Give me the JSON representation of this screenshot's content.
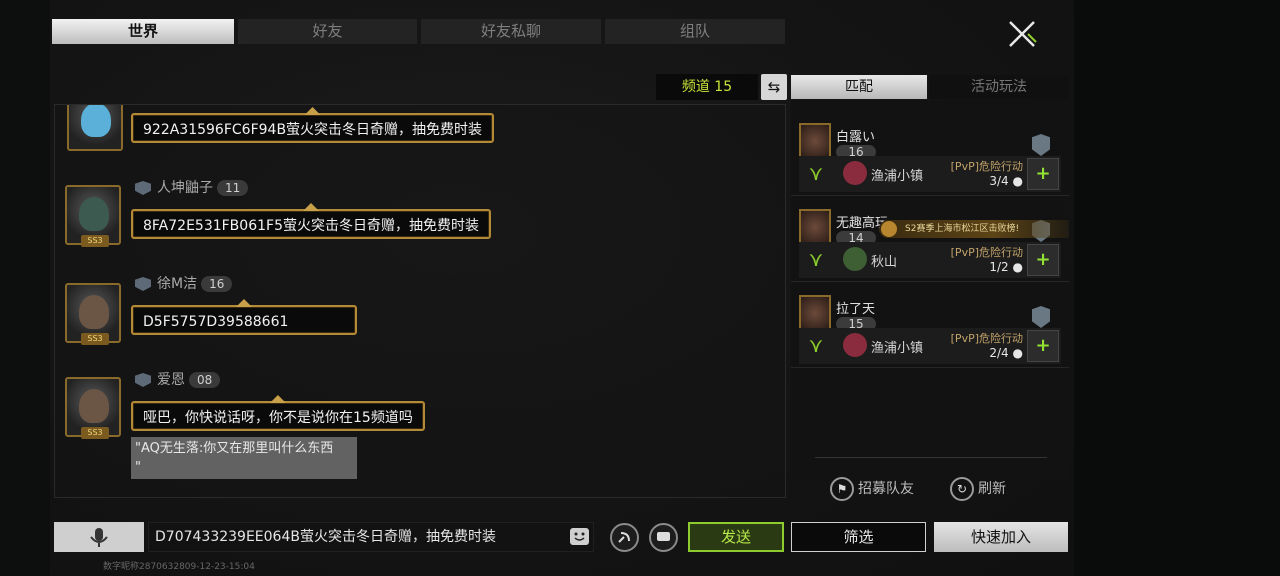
{
  "tabs": [
    {
      "label": "世界",
      "active": true
    },
    {
      "label": "好友",
      "active": false
    },
    {
      "label": "好友私聊",
      "active": false
    },
    {
      "label": "组队",
      "active": false
    }
  ],
  "channel": {
    "label": "频道 15"
  },
  "messages": [
    {
      "name": "",
      "level": "",
      "text": "922A31596FC6F94B萤火突击冬日奇赠，抽免费时装"
    },
    {
      "name": "人坤鼬子",
      "level": "11",
      "text": "8FA72E531FB061F5萤火突击冬日奇赠，抽免费时装"
    },
    {
      "name": "徐M洁",
      "level": "16",
      "text": "D5F5757D39588661"
    },
    {
      "name": "爱恩",
      "level": "08",
      "text": "哑巴，你快说话呀，你不是说你在15频道吗",
      "quote": "\"AQ无生落:你又在那里叫什么东西\n\""
    }
  ],
  "avatar_tag": "SS3",
  "input": {
    "value": "D707433239EE064B萤火突击冬日奇赠，抽免费时装"
  },
  "send_label": "发送",
  "filter_label": "筛选",
  "quickjoin_label": "快速加入",
  "footer_id": "数字昵称2870632809-12-23-15:04",
  "right_tabs": [
    {
      "label": "匹配",
      "active": true
    },
    {
      "label": "活动玩法",
      "active": false
    }
  ],
  "teams": [
    {
      "name": "白露い",
      "level": "16",
      "map": "渔浦小镇",
      "mode": "[PvP]危险行动",
      "count": "3/4",
      "banner": ""
    },
    {
      "name": "无趣高玩",
      "level": "14",
      "map": "秋山",
      "mode": "[PvP]危险行动",
      "count": "1/2",
      "banner": "S2赛季上海市松江区击败榜!"
    },
    {
      "name": "拉了天",
      "level": "15",
      "map": "渔浦小镇",
      "mode": "[PvP]危险行动",
      "count": "2/4",
      "banner": ""
    }
  ],
  "recruit_label": "招募队友",
  "refresh_label": "刷新",
  "colors": {
    "accent": "#8ecb2e",
    "channel": "#c6e33a",
    "bubble_border": "#b38a36"
  }
}
